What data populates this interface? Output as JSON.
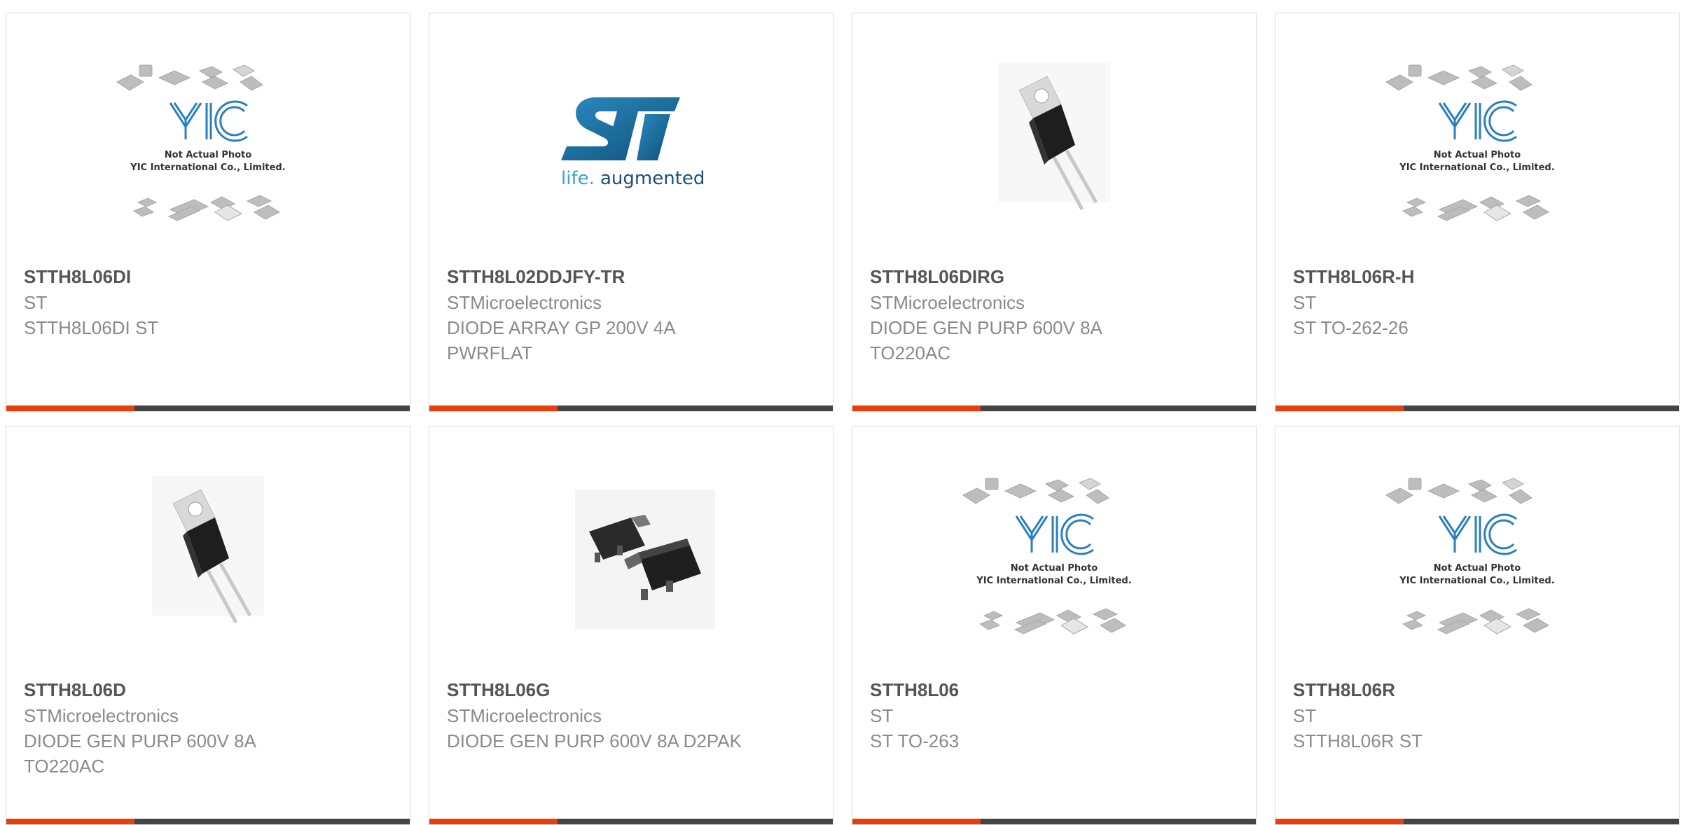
{
  "colors": {
    "accent": "#e8400c",
    "bar_dark": "#444444",
    "part_text": "#555555",
    "sub_text": "#8a8a8a",
    "st_blue": "#1d6fa3",
    "yic_blue": "#2a7fbf"
  },
  "placeholder_text": {
    "logo": "YIC",
    "line1": "Not Actual Photo",
    "line2": "YIC International Co., Limited."
  },
  "st_logo_text": {
    "life": "life.",
    "augmented": "augmented"
  },
  "products": [
    {
      "part": "STTH8L06DI",
      "manufacturer": "ST",
      "description": "STTH8L06DI ST",
      "image": "yic-placeholder"
    },
    {
      "part": "STTH8L02DDJFY-TR",
      "manufacturer": "STMicroelectronics",
      "description": "DIODE ARRAY GP 200V 4A PWRFLAT",
      "image": "st-logo"
    },
    {
      "part": "STTH8L06DIRG",
      "manufacturer": "STMicroelectronics",
      "description": "DIODE GEN PURP 600V 8A TO220AC",
      "image": "to220-diode"
    },
    {
      "part": "STTH8L06R-H",
      "manufacturer": "ST",
      "description": "ST TO-262-26",
      "image": "yic-placeholder"
    },
    {
      "part": "STTH8L06D",
      "manufacturer": "STMicroelectronics",
      "description": "DIODE GEN PURP 600V 8A TO220AC",
      "image": "to220-diode"
    },
    {
      "part": "STTH8L06G",
      "manufacturer": "STMicroelectronics",
      "description": "DIODE GEN PURP 600V 8A D2PAK",
      "image": "d2pak-package"
    },
    {
      "part": "STTH8L06",
      "manufacturer": "ST",
      "description": "ST TO-263",
      "image": "yic-placeholder"
    },
    {
      "part": "STTH8L06R",
      "manufacturer": "ST",
      "description": "STTH8L06R ST",
      "image": "yic-placeholder"
    }
  ]
}
